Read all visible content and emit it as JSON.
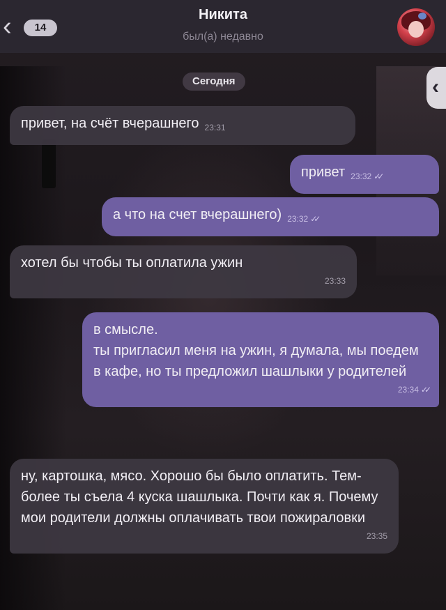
{
  "header": {
    "back_badge": "14",
    "contact_name": "Никита",
    "contact_status": "был(а) недавно",
    "icons": {
      "back": "chevron-left-icon",
      "avatar": "avatar"
    }
  },
  "chat": {
    "date_chip": "Сегодня",
    "messages": [
      {
        "direction": "in",
        "text": "привет, на счёт вчерашнего",
        "time": "23:31"
      },
      {
        "direction": "out",
        "text": "привет",
        "time": "23:32",
        "status": "read"
      },
      {
        "direction": "out",
        "text": "а что на счет вчерашнего)",
        "time": "23:32",
        "status": "read"
      },
      {
        "direction": "in",
        "text": "хотел бы чтобы ты оплатила ужин",
        "time": "23:33"
      },
      {
        "direction": "out",
        "text": "в смысле.\nты пригласил меня на ужин, я думала, мы поедем в кафе, но ты предложил шашлыки у родителей",
        "time": "23:34",
        "status": "read"
      },
      {
        "direction": "in",
        "text": "ну, картошка, мясо. Хорошо бы было оплатить. Тем-более ты съела 4 куска шашлыка. Почти как я. Почему мои родители должны оплачивать твои пожираловки",
        "time": "23:35"
      }
    ]
  },
  "colors": {
    "incoming_bubble": "#3e3842",
    "outgoing_bubble": "#6f5fa2",
    "header_bg": "#2b2730"
  }
}
